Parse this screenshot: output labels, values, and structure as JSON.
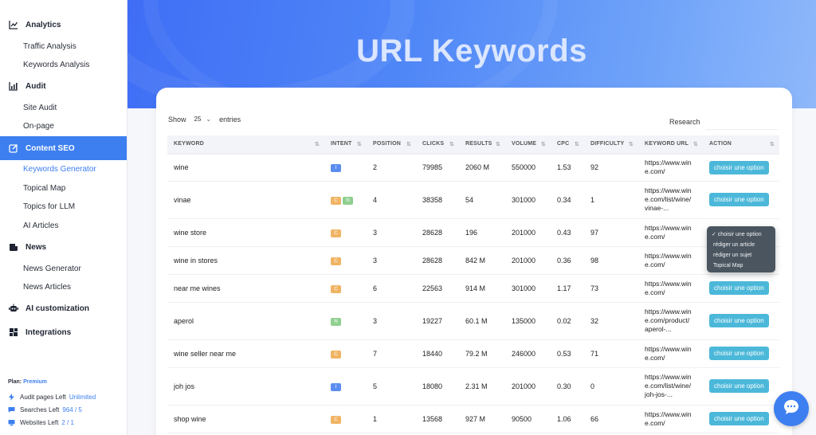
{
  "sidebar": {
    "sections": [
      {
        "label": "Analytics",
        "icon": "line-chart-icon",
        "subs": [
          "Traffic Analysis",
          "Keywords Analysis"
        ]
      },
      {
        "label": "Audit",
        "icon": "bar-chart-icon",
        "subs": [
          "Site Audit",
          "On-page"
        ]
      },
      {
        "label": "Content SEO",
        "icon": "edit-icon",
        "subs": [
          "Keywords Generator",
          "Topical Map",
          "Topics for LLM",
          "AI Articles"
        ]
      },
      {
        "label": "News",
        "icon": "news-icon",
        "subs": [
          "News Generator",
          "News Articles"
        ]
      },
      {
        "label": "AI customization",
        "icon": "robot-icon",
        "subs": []
      },
      {
        "label": "Integrations",
        "icon": "integrations-icon",
        "subs": []
      }
    ],
    "plan_label": "Plan:",
    "plan_value": "Premium",
    "quotas": [
      {
        "label": "Audit pages Left",
        "value": "Unlimited",
        "icon": "bolt-icon"
      },
      {
        "label": "Searches Left",
        "value": "964 / 5",
        "icon": "chat-icon"
      },
      {
        "label": "Websites Left",
        "value": "2 / 1",
        "icon": "monitor-icon"
      }
    ]
  },
  "header": {
    "title": "URL Keywords"
  },
  "table_controls": {
    "show_label": "Show",
    "entries_value": "25",
    "entries_label": "entries",
    "research_label": "Research"
  },
  "table": {
    "columns": [
      "KEYWORD",
      "INTENT",
      "POSITION",
      "CLICKS",
      "RESULTS",
      "VOLUME",
      "CPC",
      "DIFFICULTY",
      "KEYWORD URL",
      "ACTION"
    ],
    "rows": [
      {
        "keyword": "wine",
        "intent": [
          "I"
        ],
        "position": "2",
        "clicks": "79985",
        "results": "2060 M",
        "volume": "550000",
        "cpc": "1.53",
        "difficulty": "92",
        "url": "https://www.win\ne.com/",
        "action": "choisir une option"
      },
      {
        "keyword": "vinae",
        "intent": [
          "C",
          "N"
        ],
        "position": "4",
        "clicks": "38358",
        "results": "54",
        "volume": "301000",
        "cpc": "0.34",
        "difficulty": "1",
        "url": "https://www.win\ne.com/list/wine/\nvinae-...",
        "action": "choisir une option"
      },
      {
        "keyword": "wine store",
        "intent": [
          "C"
        ],
        "position": "3",
        "clicks": "28628",
        "results": "196",
        "volume": "201000",
        "cpc": "0.43",
        "difficulty": "97",
        "url": "https://www.win\ne.com/",
        "action": ""
      },
      {
        "keyword": "wine in stores",
        "intent": [
          "C"
        ],
        "position": "3",
        "clicks": "28628",
        "results": "842 M",
        "volume": "201000",
        "cpc": "0.36",
        "difficulty": "98",
        "url": "https://www.win\ne.com/",
        "action": ""
      },
      {
        "keyword": "near me wines",
        "intent": [
          "C"
        ],
        "position": "6",
        "clicks": "22563",
        "results": "914 M",
        "volume": "301000",
        "cpc": "1.17",
        "difficulty": "73",
        "url": "https://www.win\ne.com/",
        "action": "choisir une option"
      },
      {
        "keyword": "aperol",
        "intent": [
          "N"
        ],
        "position": "3",
        "clicks": "19227",
        "results": "60.1 M",
        "volume": "135000",
        "cpc": "0.02",
        "difficulty": "32",
        "url": "https://www.win\ne.com/product/\naperol-...",
        "action": "choisir une option"
      },
      {
        "keyword": "wine seller near me",
        "intent": [
          "C"
        ],
        "position": "7",
        "clicks": "18440",
        "results": "79.2 M",
        "volume": "246000",
        "cpc": "0.53",
        "difficulty": "71",
        "url": "https://www.win\ne.com/",
        "action": "choisir une option"
      },
      {
        "keyword": "joh jos",
        "intent": [
          "I"
        ],
        "position": "5",
        "clicks": "18080",
        "results": "2.31 M",
        "volume": "201000",
        "cpc": "0.30",
        "difficulty": "0",
        "url": "https://www.win\ne.com/list/wine/\njoh-jos-...",
        "action": "choisir une option"
      },
      {
        "keyword": "shop wine",
        "intent": [
          "C"
        ],
        "position": "1",
        "clicks": "13568",
        "results": "927 M",
        "volume": "90500",
        "cpc": "1.06",
        "difficulty": "66",
        "url": "https://www.win\ne.com/",
        "action": "choisir une option"
      }
    ]
  },
  "dropdown": {
    "options": [
      "✓ choisir une option",
      "rédiger un article",
      "rédiger un sujet",
      "Topical Map"
    ]
  },
  "colors": {
    "accent": "#3d7ff0",
    "button": "#4cb8d9"
  }
}
